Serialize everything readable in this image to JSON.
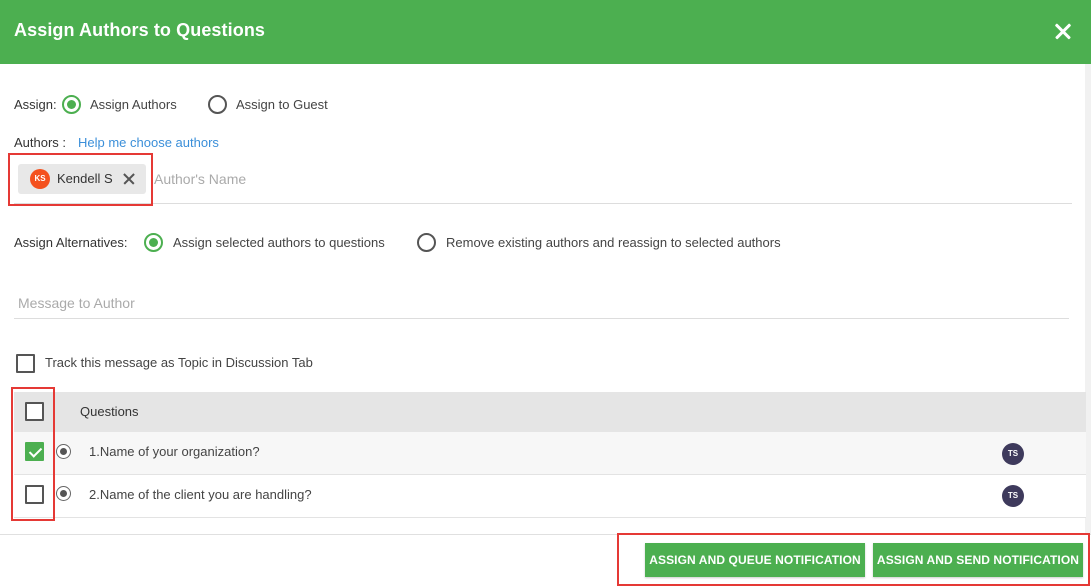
{
  "dialog": {
    "title": "Assign Authors to Questions",
    "close_icon": "close-icon"
  },
  "assign": {
    "label": "Assign:",
    "options": [
      {
        "label": "Assign Authors",
        "selected": true
      },
      {
        "label": "Assign to Guest",
        "selected": false
      }
    ]
  },
  "authors": {
    "label": "Authors :",
    "help_link": "Help me choose authors",
    "chips": [
      {
        "initials": "KS",
        "name": "Kendell S"
      }
    ],
    "input_placeholder": "Author's Name"
  },
  "alternatives": {
    "label": "Assign Alternatives:",
    "options": [
      {
        "label": "Assign selected authors to questions",
        "selected": true
      },
      {
        "label": "Remove existing authors and reassign to selected authors",
        "selected": false
      }
    ]
  },
  "message": {
    "placeholder": "Message to Author",
    "value": ""
  },
  "track": {
    "label": "Track this message as Topic in Discussion Tab",
    "checked": false
  },
  "table": {
    "header": "Questions",
    "rows": [
      {
        "text": "1.Name of your organization?",
        "checked": true,
        "assignee_initials": "TS"
      },
      {
        "text": "2.Name of the client you are handling?",
        "checked": false,
        "assignee_initials": "TS"
      }
    ]
  },
  "buttons": {
    "queue": "ASSIGN AND QUEUE NOTIFICATION",
    "send": "ASSIGN AND SEND NOTIFICATION"
  },
  "colors": {
    "accent": "#4caf50",
    "highlight": "#e53935",
    "link": "#3b8fd9",
    "avatar_ks": "#f4511e",
    "avatar_ts": "#3e3a5c"
  }
}
